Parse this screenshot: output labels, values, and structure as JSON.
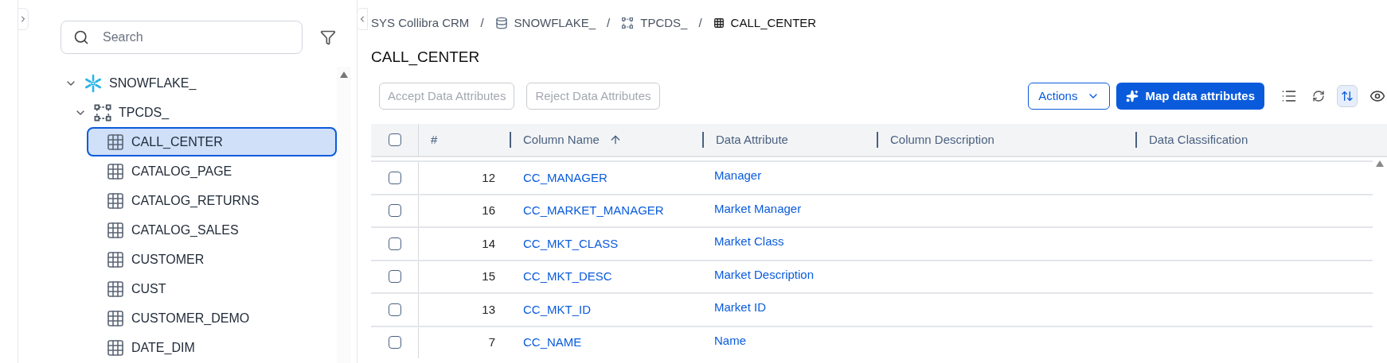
{
  "sidebar": {
    "search": {
      "placeholder": "Search"
    },
    "tree": [
      {
        "label": "SNOWFLAKE_",
        "kind": "database",
        "expanded": true,
        "selected": false,
        "children": [
          {
            "label": "TPCDS_",
            "kind": "schema",
            "expanded": true,
            "selected": false,
            "children": [
              {
                "label": "CALL_CENTER",
                "kind": "table",
                "selected": true
              },
              {
                "label": "CATALOG_PAGE",
                "kind": "table",
                "selected": false
              },
              {
                "label": "CATALOG_RETURNS",
                "kind": "table",
                "selected": false
              },
              {
                "label": "CATALOG_SALES",
                "kind": "table",
                "selected": false
              },
              {
                "label": "CUSTOMER",
                "kind": "table",
                "selected": false
              },
              {
                "label": "CUST",
                "kind": "table",
                "selected": false
              },
              {
                "label": "CUSTOMER_DEMO",
                "kind": "table",
                "selected": false
              },
              {
                "label": "DATE_DIM",
                "kind": "table",
                "selected": false
              }
            ]
          }
        ]
      }
    ]
  },
  "breadcrumb_separator": "/",
  "breadcrumb": [
    {
      "label": "SYS Collibra CRM",
      "kind": "community"
    },
    {
      "label": "SNOWFLAKE_",
      "kind": "database"
    },
    {
      "label": "TPCDS_",
      "kind": "schema"
    },
    {
      "label": "CALL_CENTER",
      "kind": "table"
    }
  ],
  "title": "CALL_CENTER",
  "toolbar": {
    "accept": {
      "label": "Accept Data Attributes",
      "disabled": true
    },
    "reject": {
      "label": "Reject Data Attributes",
      "disabled": true
    },
    "actions": "Actions",
    "map": "Map data attributes",
    "row_height_selected": true
  },
  "table": {
    "all_checked": false,
    "columns": [
      "#",
      "Column Name",
      "Data Attribute",
      "Column Description",
      "Data Classification"
    ],
    "rows": [
      {
        "number": "12",
        "column_name": "CC_MANAGER",
        "data_attribute": "Manager",
        "checked": false
      },
      {
        "number": "16",
        "column_name": "CC_MARKET_MANAGER",
        "data_attribute": "Market Manager",
        "checked": false
      },
      {
        "number": "14",
        "column_name": "CC_MKT_CLASS",
        "data_attribute": "Market Class",
        "checked": false
      },
      {
        "number": "15",
        "column_name": "CC_MKT_DESC",
        "data_attribute": "Market Description",
        "checked": false
      },
      {
        "number": "13",
        "column_name": "CC_MKT_ID",
        "data_attribute": "Market ID",
        "checked": false
      },
      {
        "number": "7",
        "column_name": "CC_NAME",
        "data_attribute": "Name",
        "checked": false
      }
    ]
  }
}
